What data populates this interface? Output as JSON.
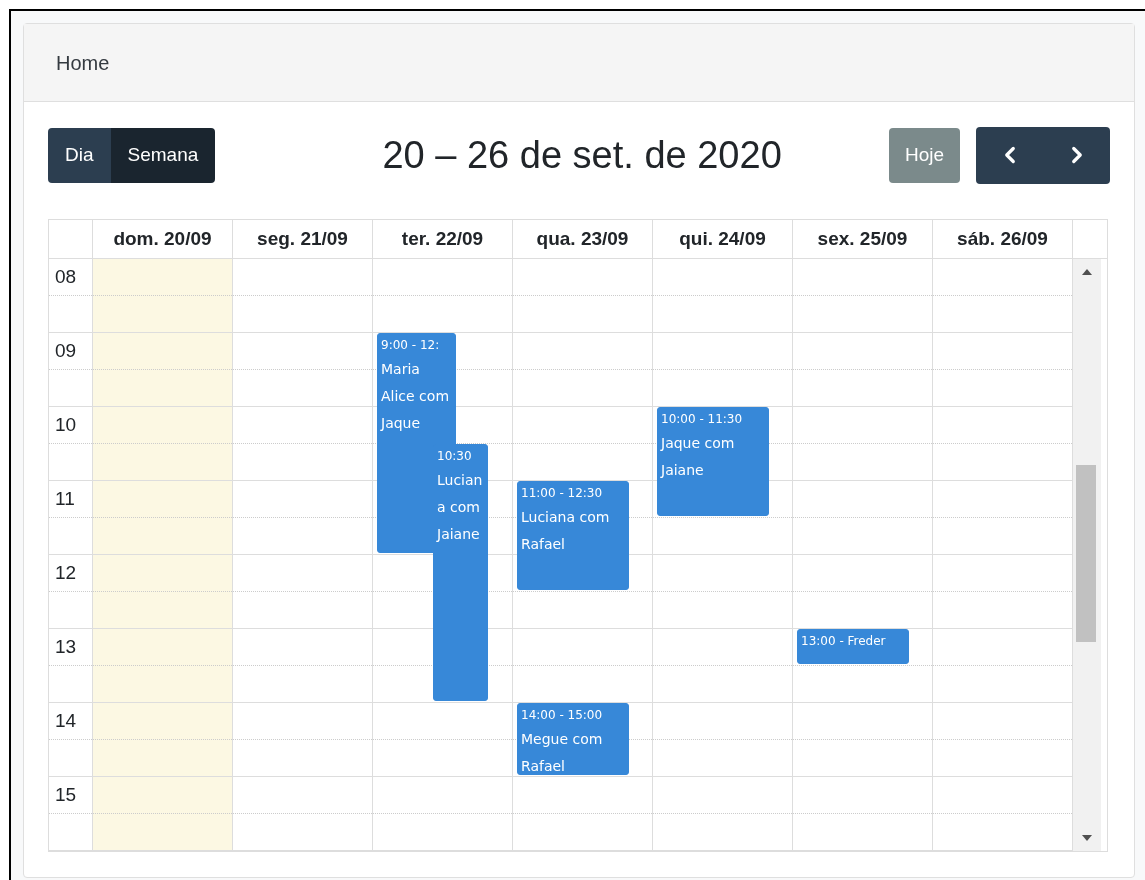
{
  "breadcrumb": "Home",
  "view_buttons": [
    {
      "label": "Dia",
      "selected": false
    },
    {
      "label": "Semana",
      "selected": true
    }
  ],
  "title": "20 – 26 de set. de 2020",
  "today_button": {
    "label": "Hoje",
    "disabled": true
  },
  "nav_buttons": [
    {
      "kind": "prev"
    },
    {
      "kind": "next"
    }
  ],
  "hours": [
    "08",
    "09",
    "10",
    "11",
    "12",
    "13",
    "14",
    "15"
  ],
  "days": [
    {
      "label": "dom. 20/09",
      "today": true
    },
    {
      "label": "seg. 21/09",
      "today": false
    },
    {
      "label": "ter. 22/09",
      "today": false,
      "events": [
        {
          "time": "9:00 - 12:",
          "title": "Maria Alice com Jaque"
        },
        {
          "time": "10:30",
          "title": "Luciana com Jaiane"
        }
      ]
    },
    {
      "label": "qua. 23/09",
      "today": false,
      "events": [
        {
          "time": "11:00 - 12:30",
          "title": "Luciana com Rafael"
        },
        {
          "time": "14:00 - 15:00",
          "title": "Megue com Rafael"
        }
      ]
    },
    {
      "label": "qui. 24/09",
      "today": false,
      "events": [
        {
          "time": "10:00 - 11:30",
          "title": "Jaque com Jaiane"
        }
      ]
    },
    {
      "label": "sex. 25/09",
      "today": false,
      "events": [
        {
          "time": "13:00 - Freder"
        }
      ]
    },
    {
      "label": "sáb. 26/09",
      "today": false
    }
  ]
}
